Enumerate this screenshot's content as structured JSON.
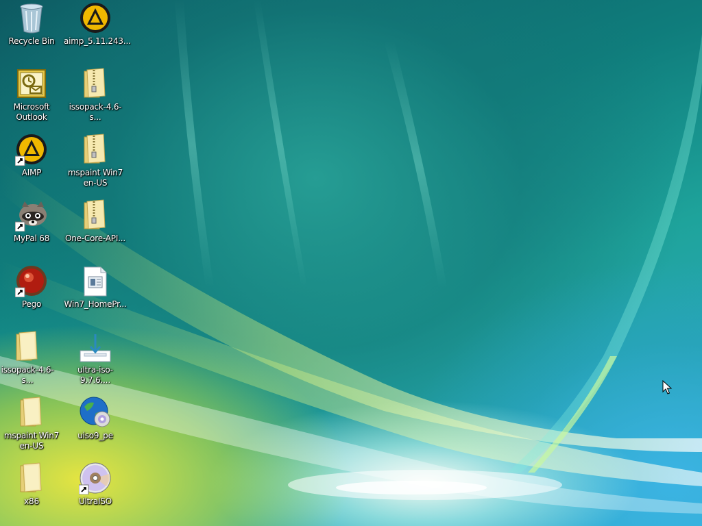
{
  "desktop": {
    "icons": [
      {
        "label": "Recycle Bin",
        "icon": "recycle-bin-icon"
      },
      {
        "label": "aimp_5.11.243...",
        "icon": "aimp-installer-icon"
      },
      {
        "label": "Microsoft\nOutlook",
        "icon": "outlook-icon"
      },
      {
        "label": "issopack-4.6-s...",
        "icon": "zip-folder-icon"
      },
      {
        "label": "AIMP",
        "icon": "aimp-icon"
      },
      {
        "label": "mspaint Win7\nen-US",
        "icon": "zip-folder-icon"
      },
      {
        "label": "MyPal 68",
        "icon": "mypal-icon"
      },
      {
        "label": "One-Core-API...",
        "icon": "zip-folder-icon"
      },
      {
        "label": "Pego",
        "icon": "pego-icon"
      },
      {
        "label": "Win7_HomePr...",
        "icon": "document-icon"
      },
      {
        "label": "issopack-4.6-s...",
        "icon": "folder-icon"
      },
      {
        "label": "ultra-iso-9.7.6....",
        "icon": "installer-icon"
      },
      {
        "label": "mspaint Win7\nen-US",
        "icon": "folder-icon"
      },
      {
        "label": "uiso9_pe",
        "icon": "globe-disc-icon"
      },
      {
        "label": "x86",
        "icon": "folder-icon"
      },
      {
        "label": "UltraISO",
        "icon": "disc-icon"
      }
    ]
  },
  "colors": {
    "label_text": "#ffffff",
    "folder": "#f3e3a0",
    "aimp_ring": "#f0b800"
  }
}
